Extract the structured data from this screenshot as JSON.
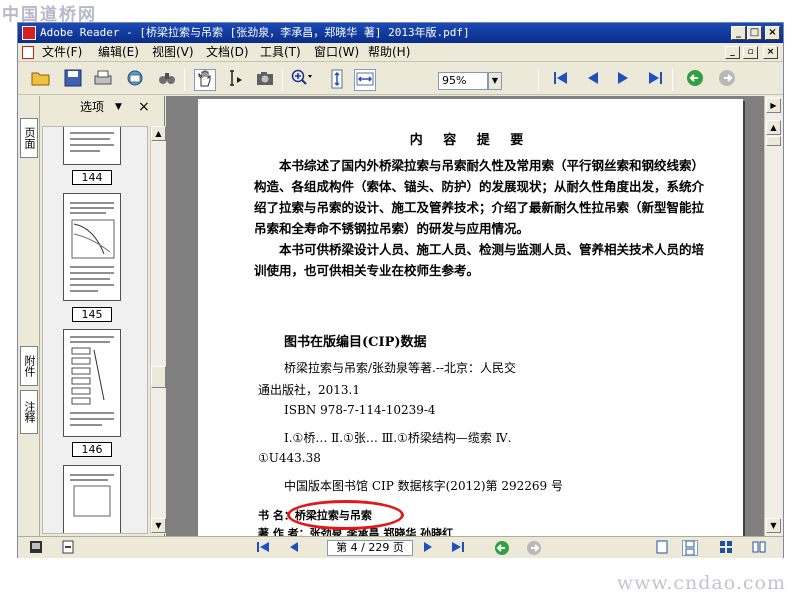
{
  "watermark": {
    "top": "中国道桥网",
    "bottom": "www.cndao.com"
  },
  "window": {
    "title": "Adobe Reader - [桥梁拉索与吊索 [张劲泉，李承昌，郑晓华 著] 2013年版.pdf]",
    "controls": {
      "minimize": "_",
      "maximize": "□",
      "close": "×"
    },
    "doc_controls": {
      "minimize": "_",
      "restore": "▫",
      "close": "×"
    }
  },
  "menu": {
    "items": [
      {
        "label": "文件(F)"
      },
      {
        "label": "编辑(E)"
      },
      {
        "label": "视图(V)"
      },
      {
        "label": "文档(D)"
      },
      {
        "label": "工具(T)"
      },
      {
        "label": "窗口(W)"
      },
      {
        "label": "帮助(H)"
      }
    ]
  },
  "toolbar": {
    "zoom_value": "95%",
    "zoom_in": "+",
    "zoom_out": "−"
  },
  "sidebar": {
    "tabs": [
      {
        "label": "页面"
      },
      {
        "label": "附件"
      },
      {
        "label": "注释"
      }
    ],
    "options_label": "选项",
    "close_label": "×",
    "thumbnails": [
      {
        "label": "144"
      },
      {
        "label": "145"
      },
      {
        "label": "146"
      }
    ]
  },
  "document": {
    "summary_title": "内 容 提 要",
    "summary_para1": "本书综述了国内外桥梁拉索与吊索耐久性及常用索（平行钢丝索和钢绞线索）构造、各组成构件（索体、锚头、防护）的发展现状；从耐久性角度出发，系统介绍了拉索与吊索的设计、施工及管养技术；介绍了最新耐久性拉吊索（新型智能拉吊索和全寿命不锈钢拉吊索）的研发与应用情况。",
    "summary_para2": "本书可供桥梁设计人员、施工人员、检测与监测人员、管养相关技术人员的培训使用，也可供相关专业在校师生参考。",
    "cip_title": "图书在版编目(CIP)数据",
    "cip_line1": "桥梁拉索与吊索/张劲泉等著.--北京：人民交",
    "cip_line2": "通出版社，2013.1",
    "cip_line3": "ISBN  978-7-114-10239-4",
    "cip_line4": "Ⅰ.①桥…  Ⅱ.①张…  Ⅲ.①桥梁结构—缆索  Ⅳ.",
    "cip_line5": "①U443.38",
    "cip_line6": "中国版本图书馆 CIP 数据核字(2012)第 292269 号",
    "book_line1_key": "书    名：",
    "book_line1_val": "桥梁拉索与吊索",
    "book_line2": "著 作 者：张劲泉  李承昌  郑晓华  孙晓红"
  },
  "statusbar": {
    "page_display": "第 4 / 229 页"
  },
  "colors": {
    "titlebar": "#0a2d86",
    "highlight_ellipse": "#e01818"
  }
}
